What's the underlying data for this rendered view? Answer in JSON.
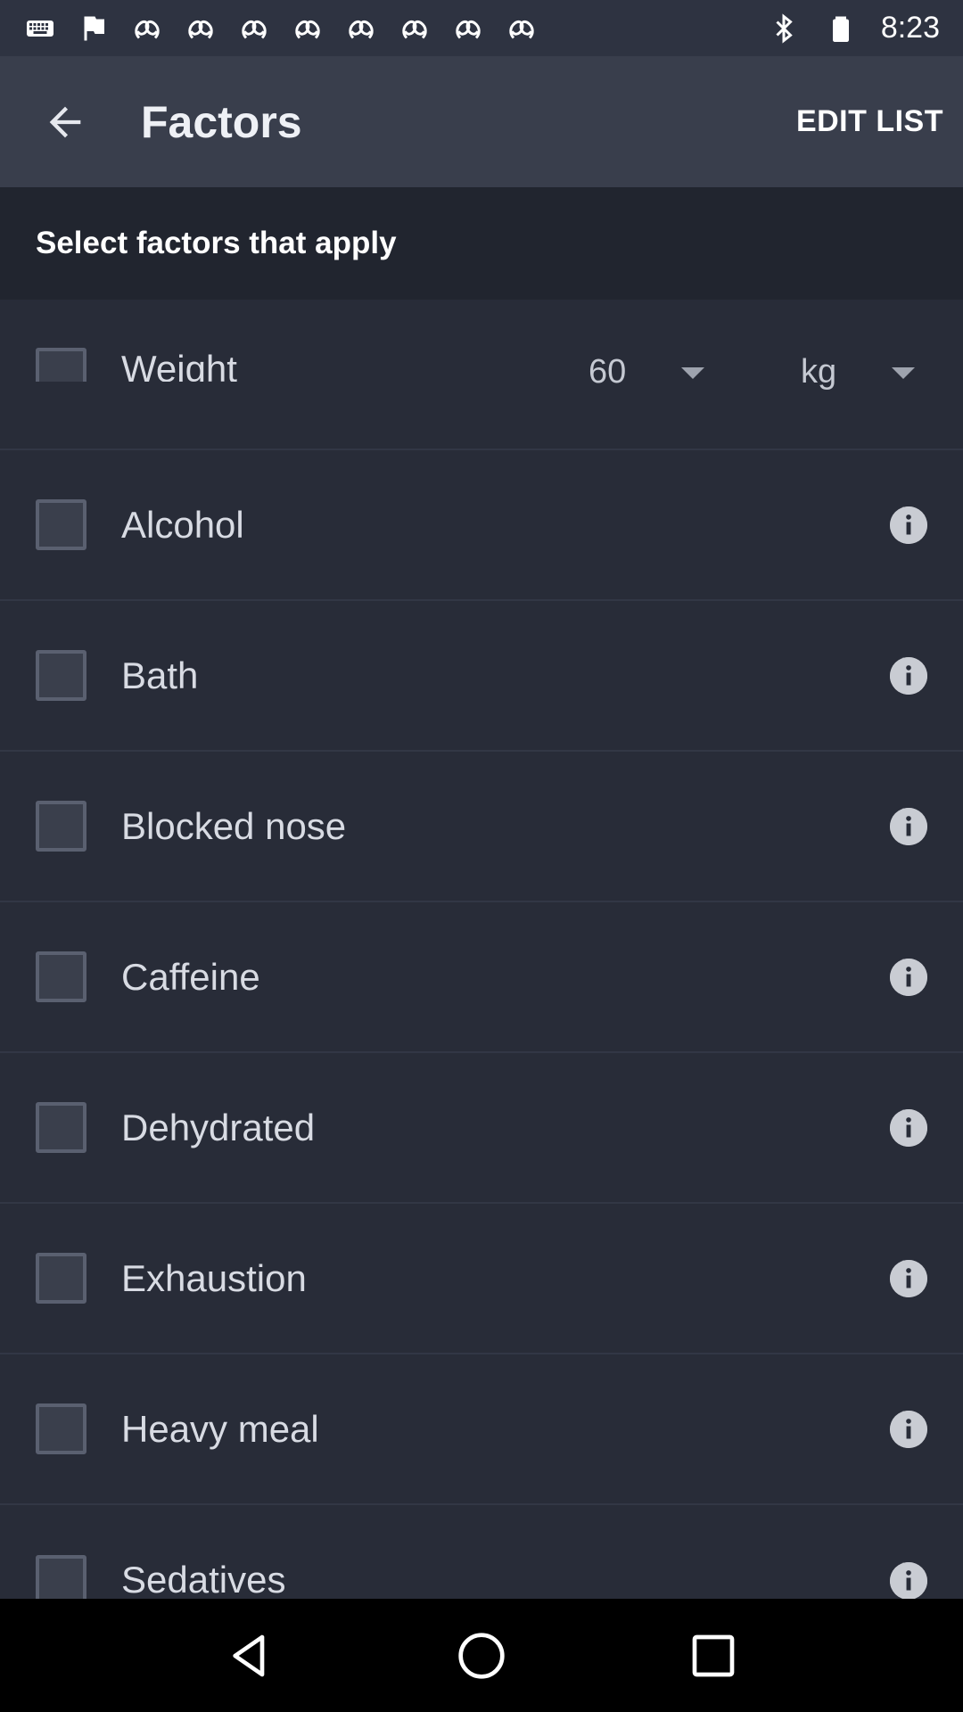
{
  "status_bar": {
    "time": "8:23",
    "left_icons": [
      "keyboard-icon",
      "flag-icon",
      "pretzel-icon",
      "pretzel-icon",
      "pretzel-icon",
      "pretzel-icon",
      "pretzel-icon",
      "pretzel-icon",
      "pretzel-icon",
      "pretzel-icon"
    ],
    "right_icons": [
      "bluetooth-icon",
      "battery-icon"
    ]
  },
  "app_bar": {
    "title": "Factors",
    "edit_label": "EDIT LIST"
  },
  "section": {
    "title": "Select factors that apply"
  },
  "weight": {
    "label": "Weight",
    "value": "60",
    "unit": "kg"
  },
  "factors": [
    {
      "label": "Alcohol"
    },
    {
      "label": "Bath"
    },
    {
      "label": "Blocked nose"
    },
    {
      "label": "Caffeine"
    },
    {
      "label": "Dehydrated"
    },
    {
      "label": "Exhaustion"
    },
    {
      "label": "Heavy meal"
    },
    {
      "label": "Sedatives"
    }
  ],
  "nav": {
    "buttons": [
      "back-icon",
      "home-icon",
      "recents-icon"
    ]
  },
  "colors": {
    "app_bar": "#393e4c",
    "section_header": "#21252f",
    "list_background": "#282c38"
  }
}
